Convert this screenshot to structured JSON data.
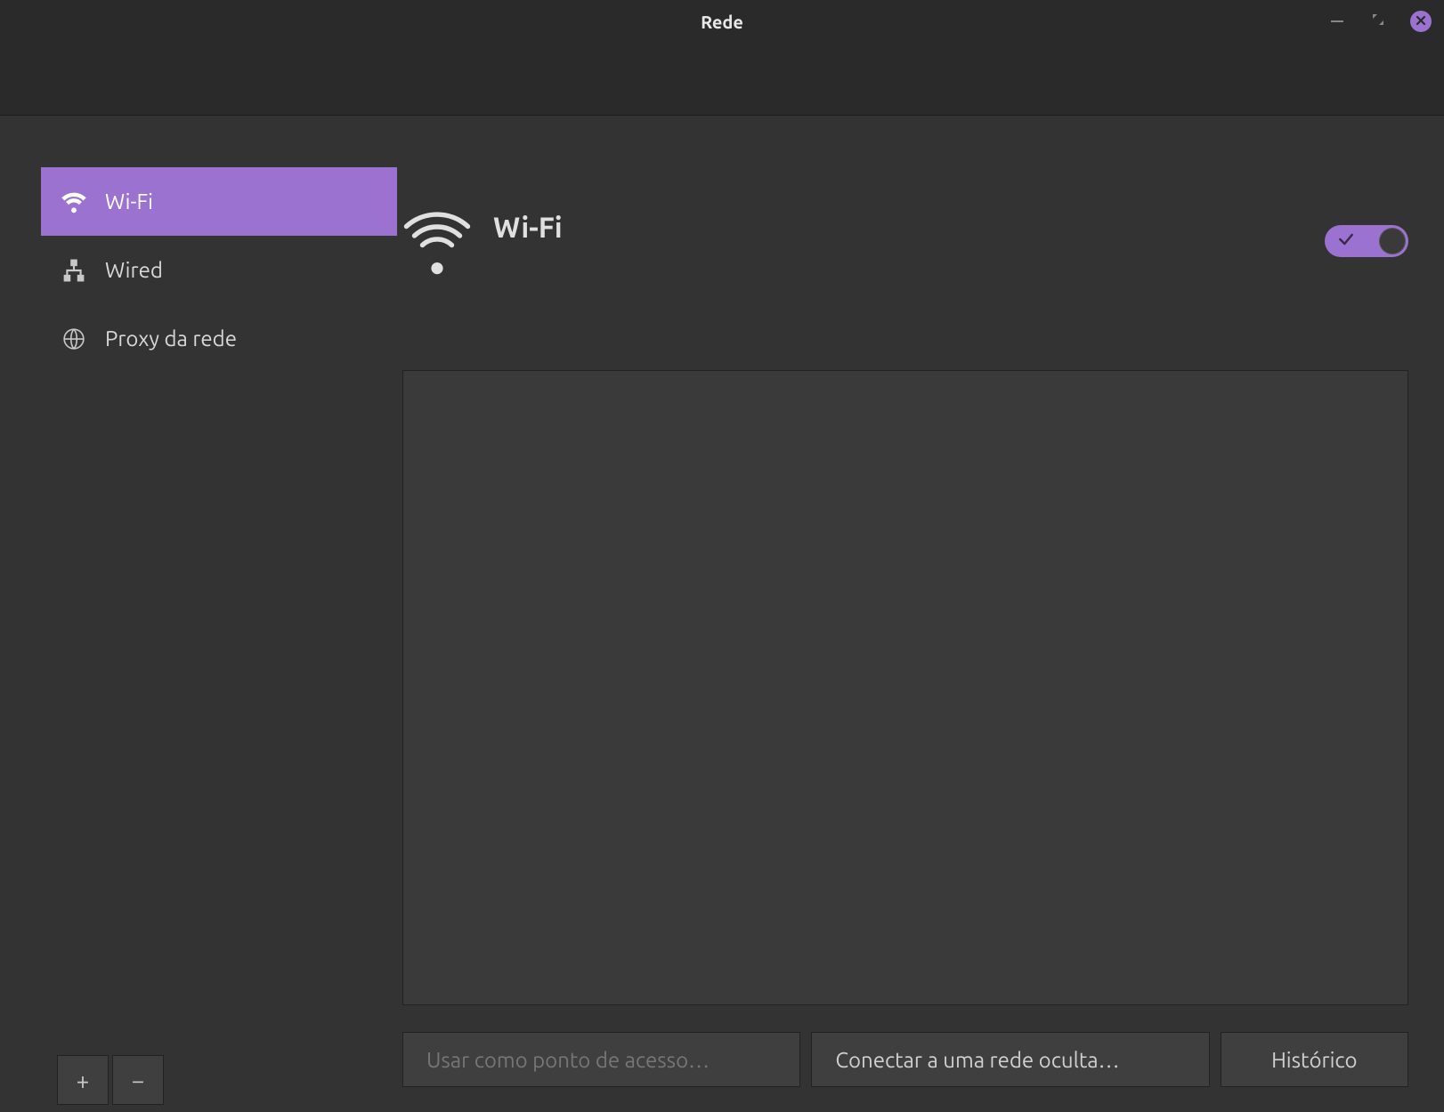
{
  "window": {
    "title": "Rede"
  },
  "sidebar": {
    "items": [
      {
        "label": "Wi-Fi",
        "icon": "wifi",
        "active": true
      },
      {
        "label": "Wired",
        "icon": "wired",
        "active": false
      },
      {
        "label": "Proxy da rede",
        "icon": "globe",
        "active": false
      }
    ]
  },
  "main": {
    "title": "Wi-Fi",
    "wifi_enabled": true
  },
  "actions": {
    "hotspot": "Usar como ponto de acesso…",
    "connect_hidden": "Conectar a uma rede oculta…",
    "history": "Histórico"
  }
}
